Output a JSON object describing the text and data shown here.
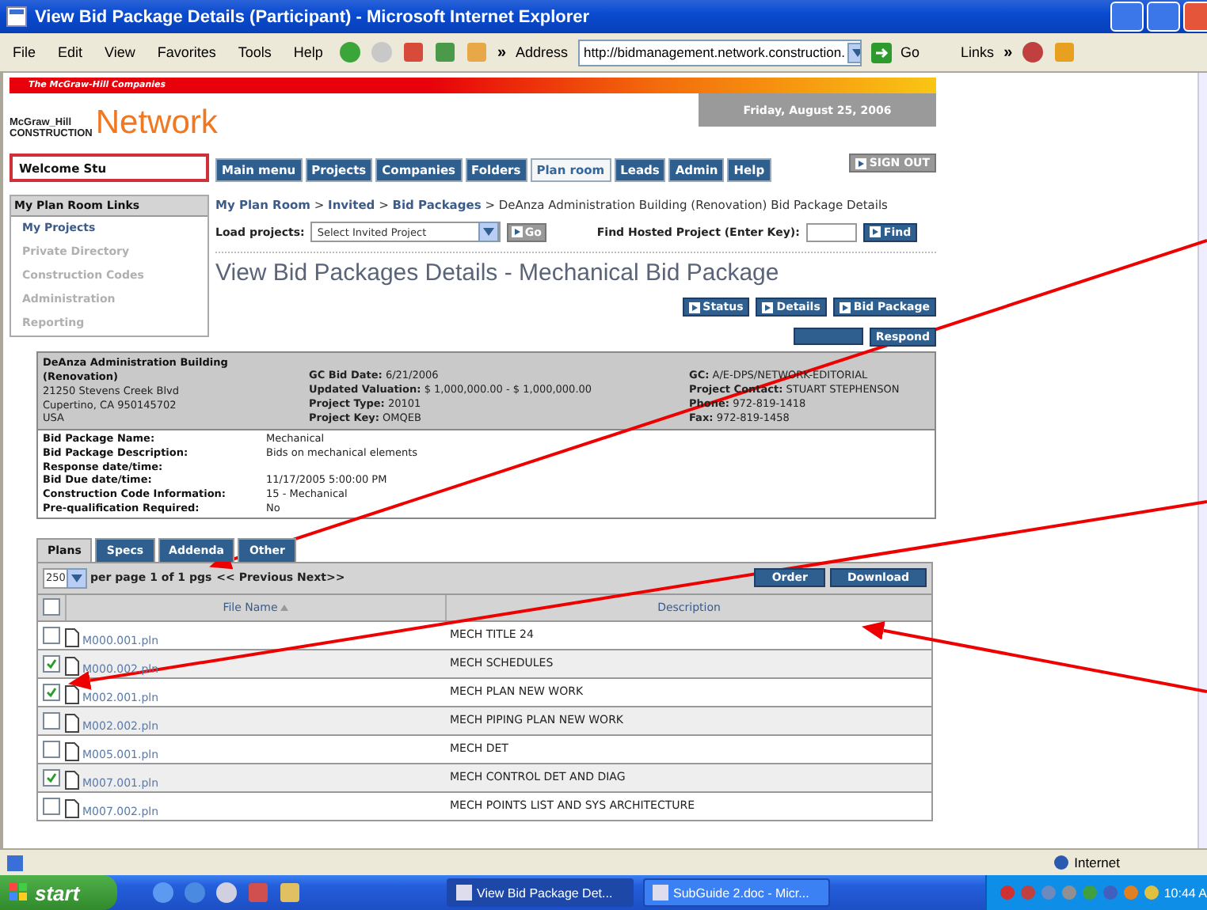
{
  "window": {
    "title": "View Bid Package Details (Participant) - Microsoft Internet Explorer"
  },
  "menu": [
    "File",
    "Edit",
    "View",
    "Favorites",
    "Tools",
    "Help"
  ],
  "toolbar_chevron": "»",
  "address": {
    "label": "Address",
    "value": "http://bidmanagement.network.construction.",
    "go": "Go",
    "links": "Links",
    "chevron": "»"
  },
  "header": {
    "company": "The McGraw-Hill Companies",
    "logo_top": "McGraw_Hill",
    "logo_bottom": "CONSTRUCTION",
    "logo_brand": "Network",
    "date": "Friday, August 25, 2006"
  },
  "welcome": "Welcome Stu",
  "nav_tabs": [
    {
      "label": "Main menu",
      "selected": false
    },
    {
      "label": "Projects",
      "selected": false
    },
    {
      "label": "Companies",
      "selected": false
    },
    {
      "label": "Folders",
      "selected": false
    },
    {
      "label": "Plan room",
      "selected": true
    },
    {
      "label": "Leads",
      "selected": false
    },
    {
      "label": "Admin",
      "selected": false
    },
    {
      "label": "Help",
      "selected": false
    }
  ],
  "sign_out": "SIGN OUT",
  "sidebar": {
    "title": "My Plan Room Links",
    "items": [
      {
        "label": "My Projects",
        "disabled": false
      },
      {
        "label": "Private Directory",
        "disabled": true
      },
      {
        "label": "Construction Codes",
        "disabled": true
      },
      {
        "label": "Administration",
        "disabled": true
      },
      {
        "label": "Reporting",
        "disabled": true
      }
    ]
  },
  "breadcrumb": {
    "links": [
      "My Plan Room",
      "Invited",
      "Bid Packages"
    ],
    "separator": ">",
    "current": "DeAnza Administration Building (Renovation) Bid Package Details"
  },
  "load_projects": {
    "label": "Load projects:",
    "value": "Select Invited Project",
    "button": "Go"
  },
  "find_hosted": {
    "label": "Find Hosted Project (Enter Key):",
    "button": "Find"
  },
  "heading": "View Bid Packages Details - Mechanical Bid Package",
  "action_buttons": [
    "Status",
    "Details",
    "Bid Package"
  ],
  "respond_button": "Respond",
  "project": {
    "name_lines": [
      "DeAnza Administration Building",
      "(Renovation)"
    ],
    "address_lines": [
      "21250 Stevens Creek Blvd",
      "Cupertino, CA  950145702",
      "USA"
    ],
    "middle": [
      {
        "label": "GC Bid Date:",
        "value": "6/21/2006"
      },
      {
        "label": "Updated Valuation:",
        "value": "$ 1,000,000.00 - $ 1,000,000.00"
      },
      {
        "label": "Project Type:",
        "value": "20101"
      },
      {
        "label": "Project Key:",
        "value": "OMQEB"
      }
    ],
    "right": [
      {
        "label": "GC:",
        "value": "A/E-DPS/NETWORK-EDITORIAL"
      },
      {
        "label": "Project Contact:",
        "value": "STUART STEPHENSON"
      },
      {
        "label": "Phone:",
        "value": "972-819-1418"
      },
      {
        "label": "Fax:",
        "value": "972-819-1458"
      }
    ]
  },
  "details": [
    {
      "label": "Bid Package Name:",
      "value": "Mechanical"
    },
    {
      "label": "Bid Package Description:",
      "value": "Bids on mechanical elements"
    },
    {
      "label": "Response date/time:"
    },
    {
      "label": "Bid Due date/time:",
      "value": "11/17/2005 5:00:00 PM"
    },
    {
      "label": "Construction Code Information:",
      "value": "15 - Mechanical"
    },
    {
      "label": "Pre-qualification Required:",
      "value": "No"
    }
  ],
  "file_tabs": [
    {
      "label": "Plans",
      "selected": true
    },
    {
      "label": "Specs",
      "selected": false
    },
    {
      "label": "Addenda",
      "selected": false
    },
    {
      "label": "Other",
      "selected": false
    }
  ],
  "pager": {
    "per_page": "250",
    "text": "per page 1 of 1 pgs",
    "nav": "<< Previous Next>>"
  },
  "table_buttons": [
    "Order",
    "Download"
  ],
  "columns": [
    "File Name",
    "Description"
  ],
  "select_all": {
    "checked": false
  },
  "rows": [
    {
      "file": "M000.001.pln",
      "description": "MECH TITLE 24",
      "checked": false
    },
    {
      "file": "M000.002.pln",
      "description": "MECH SCHEDULES",
      "checked": true
    },
    {
      "file": "M002.001.pln",
      "description": "MECH PLAN NEW WORK",
      "checked": true
    },
    {
      "file": "M002.002.pln",
      "description": "MECH PIPING PLAN NEW WORK",
      "checked": false
    },
    {
      "file": "M005.001.pln",
      "description": "MECH DET",
      "checked": false
    },
    {
      "file": "M007.001.pln",
      "description": "MECH CONTROL DET AND DIAG",
      "checked": true
    },
    {
      "file": "M007.002.pln",
      "description": "MECH POINTS LIST AND SYS ARCHITECTURE",
      "checked": false
    }
  ],
  "status_bar": {
    "zone": "Internet"
  },
  "taskbar": {
    "start": "start",
    "tasks": [
      {
        "label": "View Bid Package Det...",
        "selected": true
      },
      {
        "label": "SubGuide 2.doc - Micr...",
        "selected": false
      }
    ],
    "clock": "10:44 A"
  }
}
